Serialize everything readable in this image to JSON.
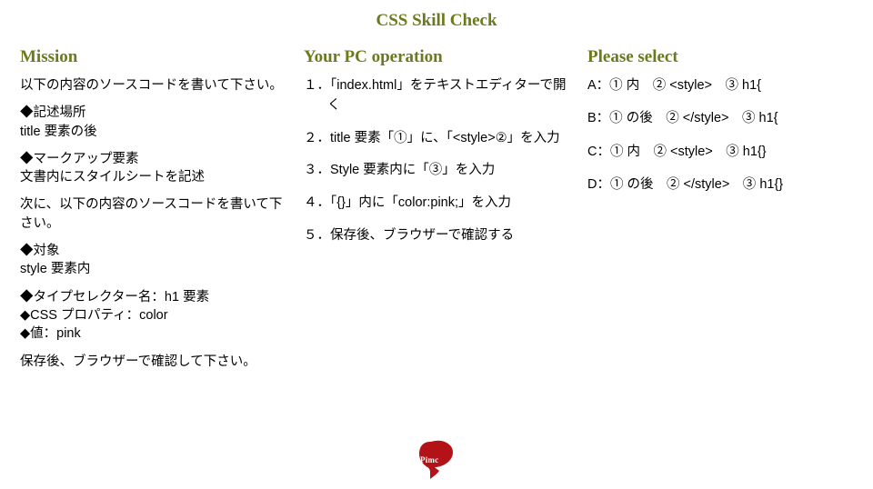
{
  "title": "CSS Skill Check",
  "mission": {
    "heading": "Mission",
    "p1": "以下の内容のソースコードを書いて下さい。",
    "p2": "◆記述場所\ntitle 要素の後",
    "p3": "◆マークアップ要素\n文書内にスタイルシートを記述",
    "p4": "次に、以下の内容のソースコードを書いて下さい。",
    "p5": "◆対象\nstyle 要素内",
    "p6": "◆タイプセレクター名：h1 要素\n◆CSS プロパティ：color\n◆値：pink",
    "p7": "保存後、ブラウザーで確認して下さい。"
  },
  "operation": {
    "heading": "Your PC operation",
    "steps": [
      "１．「index.html」をテキストエディターで開く",
      "２．title 要素「①」に、「<style>②」を入力",
      "３．Style 要素内に「③」を入力",
      "４．「{}」内に「color:pink;」を入力",
      "５．保存後、ブラウザーで確認する"
    ]
  },
  "select": {
    "heading": "Please select",
    "optA": "A：① 内　② <style>　③ h1{",
    "optB": "B：① の後　② </style>　③ h1{",
    "optC": "C：① 内　② <style>　③ h1{}",
    "optD": "D：① の後　② </style>　③ h1{}"
  },
  "logo_text": "Pimc"
}
